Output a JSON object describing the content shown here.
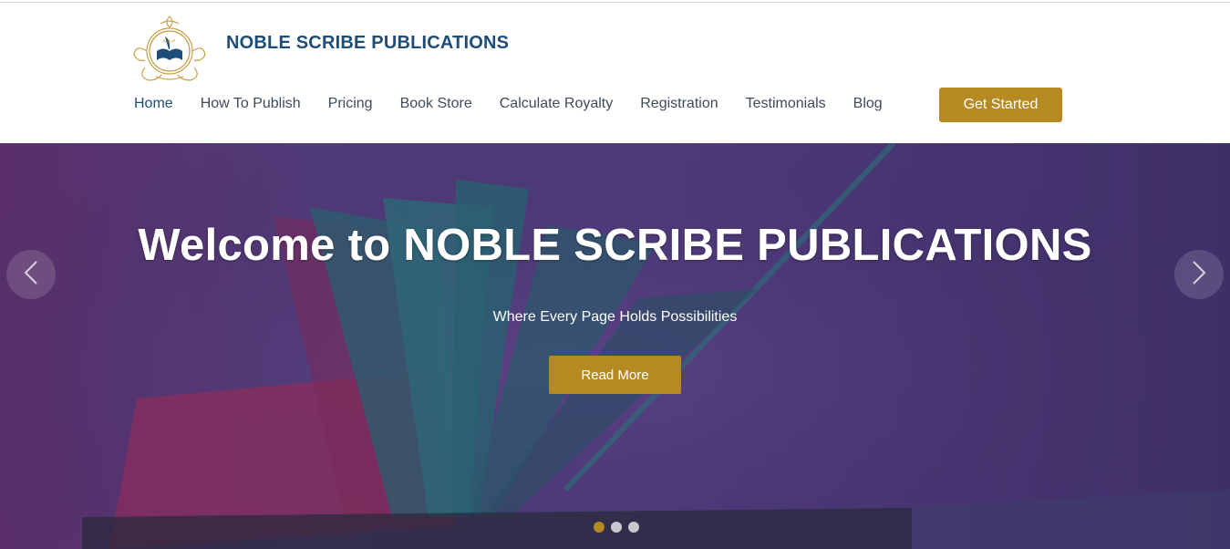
{
  "header": {
    "brand": "NOBLE SCRIBE PUBLICATIONS",
    "logo_icon": "ornate-book-quill-logo",
    "nav": [
      {
        "label": "Home",
        "active": true
      },
      {
        "label": "How To Publish",
        "active": false
      },
      {
        "label": "Pricing",
        "active": false
      },
      {
        "label": "Book Store",
        "active": false
      },
      {
        "label": "Calculate Royalty",
        "active": false
      },
      {
        "label": "Registration",
        "active": false
      },
      {
        "label": "Testimonials",
        "active": false
      },
      {
        "label": "Blog",
        "active": false
      }
    ],
    "cta_label": "Get Started"
  },
  "hero": {
    "title": "Welcome to NOBLE SCRIBE PUBLICATIONS",
    "subtitle": "Where Every Page Holds Possibilities",
    "button_label": "Read More",
    "prev_icon": "chevron-left-icon",
    "next_icon": "chevron-right-icon",
    "slides_count": 3,
    "active_slide": 1
  },
  "colors": {
    "brand": "#1f4d7a",
    "accent": "#b58a23",
    "hero_overlay": "#4d3a7a"
  }
}
